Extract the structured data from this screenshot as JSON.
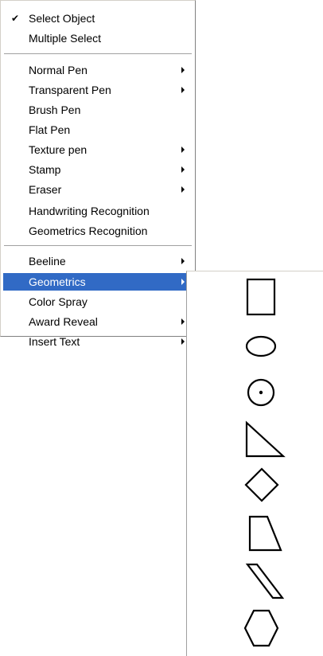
{
  "menu": {
    "items": [
      {
        "label": "Select Object",
        "checked": true
      },
      {
        "label": "Multiple Select"
      },
      {
        "label": "Normal Pen",
        "submenu": true
      },
      {
        "label": "Transparent Pen",
        "submenu": true
      },
      {
        "label": "Brush Pen"
      },
      {
        "label": "Flat Pen"
      },
      {
        "label": "Texture pen",
        "submenu": true
      },
      {
        "label": "Stamp",
        "submenu": true
      },
      {
        "label": "Eraser",
        "submenu": true
      },
      {
        "label": "Handwriting Recognition"
      },
      {
        "label": "Geometrics Recognition"
      },
      {
        "label": "Beeline",
        "submenu": true
      },
      {
        "label": "Geometrics",
        "submenu": true,
        "highlighted": true
      },
      {
        "label": "Color Spray"
      },
      {
        "label": "Award Reveal",
        "submenu": true
      },
      {
        "label": "Insert Text",
        "submenu": true
      }
    ],
    "check_glyph": "✔",
    "highlight_color": "#316ac5"
  },
  "geometrics_submenu": {
    "shapes": [
      "rectangle-icon",
      "ellipse-icon",
      "circle-with-center-icon",
      "right-triangle-icon",
      "diamond-icon",
      "trapezoid-icon",
      "parallelogram-icon",
      "hexagon-icon"
    ]
  }
}
